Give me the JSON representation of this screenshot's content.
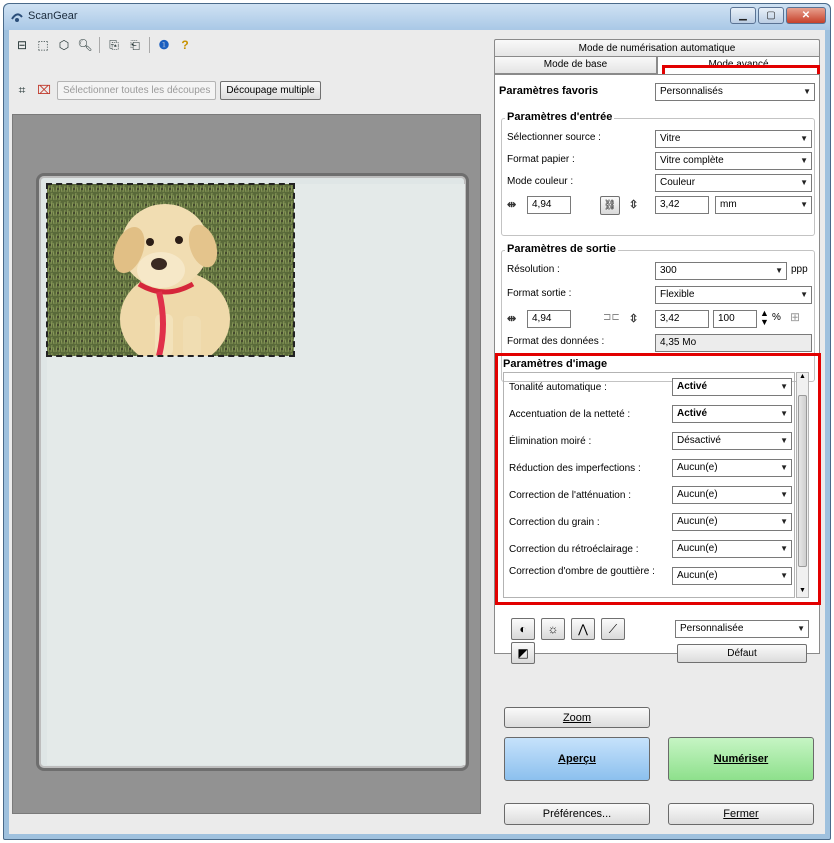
{
  "window": {
    "title": "ScanGear"
  },
  "toolbar": {
    "select_all_crops": "Sélectionner toutes les découpes",
    "multi_crop": "Découpage multiple"
  },
  "tabs": {
    "auto": "Mode de numérisation automatique",
    "basic": "Mode de base",
    "advanced": "Mode avancé"
  },
  "favorites": {
    "label": "Paramètres favoris",
    "value": "Personnalisés"
  },
  "input": {
    "title": "Paramètres d'entrée",
    "source_label": "Sélectionner source :",
    "source_value": "Vitre",
    "paper_label": "Format papier :",
    "paper_value": "Vitre complète",
    "color_label": "Mode couleur :",
    "color_value": "Couleur",
    "width": "4,94",
    "height": "3,42",
    "unit": "mm"
  },
  "output": {
    "title": "Paramètres de sortie",
    "resolution_label": "Résolution :",
    "resolution_value": "300",
    "resolution_unit": "ppp",
    "format_label": "Format sortie :",
    "format_value": "Flexible",
    "width": "4,94",
    "height": "3,42",
    "scale": "100",
    "scale_unit": "%",
    "data_size_label": "Format des données :",
    "data_size_value": "4,35 Mo"
  },
  "image_settings": {
    "title": "Paramètres d'image",
    "rows": [
      {
        "label": "Tonalité automatique :",
        "value": "Activé",
        "bold": true
      },
      {
        "label": "Accentuation de la netteté :",
        "value": "Activé",
        "bold": true
      },
      {
        "label": "Élimination moiré :",
        "value": "Désactivé",
        "bold": false
      },
      {
        "label": "Réduction des imperfections :",
        "value": "Aucun(e)",
        "bold": false
      },
      {
        "label": "Correction de l'atténuation :",
        "value": "Aucun(e)",
        "bold": false
      },
      {
        "label": "Correction du grain :",
        "value": "Aucun(e)",
        "bold": false
      },
      {
        "label": "Correction du rétroéclairage :",
        "value": "Aucun(e)",
        "bold": false
      },
      {
        "label": "Correction d'ombre de gouttière :",
        "value": "Aucun(e)",
        "bold": false
      }
    ]
  },
  "color_tools": {
    "preset": "Personnalisée",
    "default_label": "Défaut"
  },
  "buttons": {
    "zoom": "Zoom",
    "preview": "Aperçu",
    "scan": "Numériser",
    "preferences": "Préférences...",
    "close": "Fermer"
  },
  "colors": {
    "highlight": "#e20000",
    "preview_btn": "#8cc0ee",
    "scan_btn": "#8ee08c"
  }
}
